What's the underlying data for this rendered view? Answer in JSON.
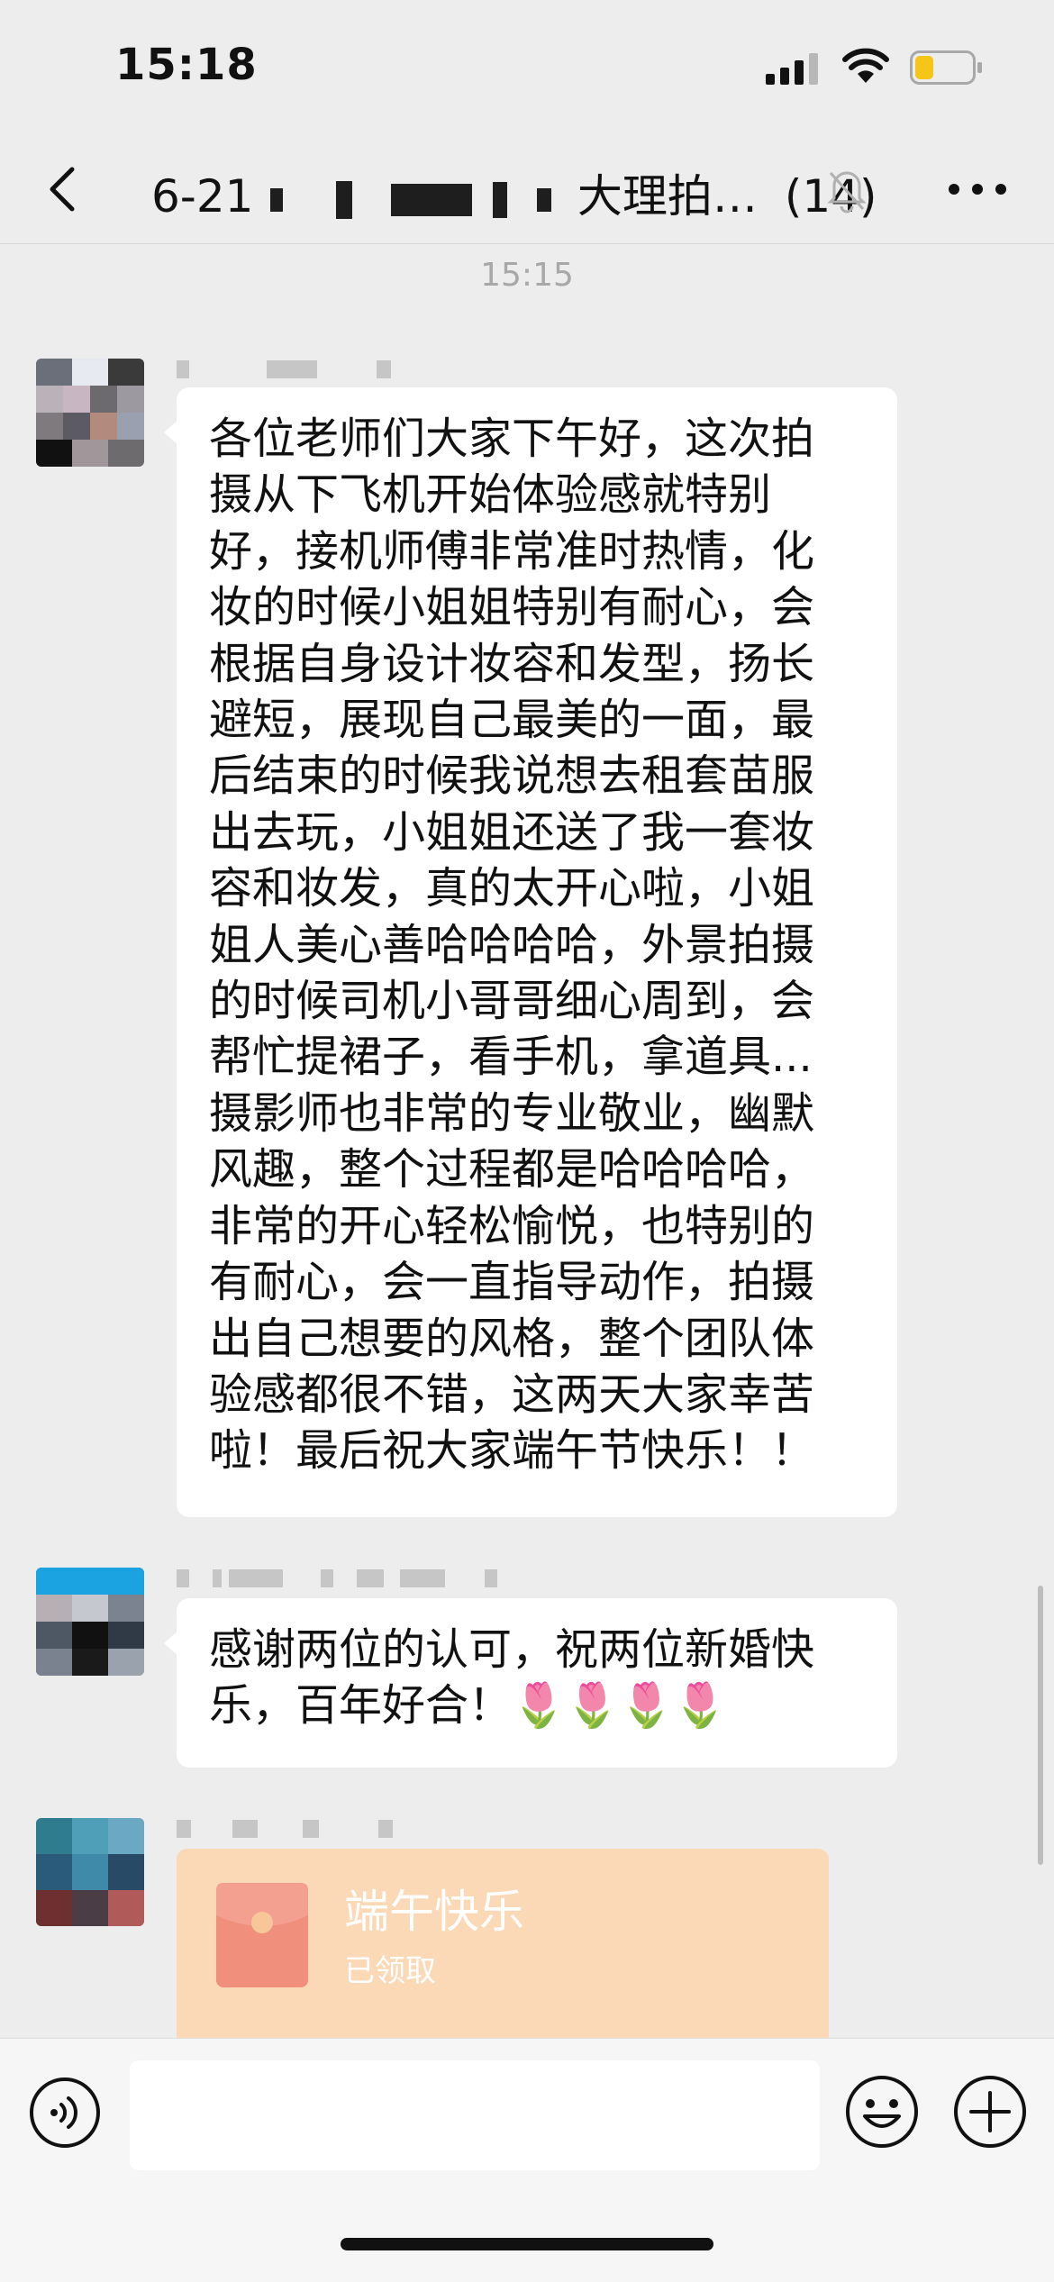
{
  "status_bar": {
    "time": "15:18"
  },
  "header": {
    "title_prefix": "6-21",
    "title_suffix": "大理拍…",
    "member_count": "(14)"
  },
  "timestamp": "15:15",
  "messages": [
    {
      "text": "各位老师们大家下午好，这次拍\n摄从下飞机开始体验感就特别\n好，接机师傅非常准时热情，化\n妆的时候小姐姐特别有耐心，会\n根据自身设计妆容和发型，扬长\n避短，展现自己最美的一面，最\n后结束的时候我说想去租套苗服\n出去玩，小姐姐还送了我一套妆\n容和妆发，真的太开心啦，小姐\n姐人美心善哈哈哈哈，外景拍摄\n的时候司机小哥哥细心周到，会\n帮忙提裙子，看手机，拿道具...\n摄影师也非常的专业敬业，幽默\n风趣，整个过程都是哈哈哈哈，\n非常的开心轻松愉悦，也特别的\n有耐心，会一直指导动作，拍摄\n出自己想要的风格，整个团队体\n验感都很不错，这两天大家幸苦\n啦！最后祝大家端午节快乐！！"
    },
    {
      "text": "感谢两位的认可，祝两位新婚快\n乐，百年好合！🌷🌷🌷🌷"
    }
  ],
  "red_packet": {
    "title": "端午快乐",
    "status": "已领取"
  },
  "input": {
    "placeholder": ""
  },
  "icons": {
    "back": "chevron-left-icon",
    "mute": "bell-off-icon",
    "more": "more-dots-icon",
    "voice": "voice-icon",
    "emoji": "smile-icon",
    "add": "plus-circle-icon"
  },
  "colors": {
    "background": "#ededed",
    "bubble": "#ffffff",
    "red_packet": "#fbd9b7",
    "battery_fill": "#f5c518"
  }
}
